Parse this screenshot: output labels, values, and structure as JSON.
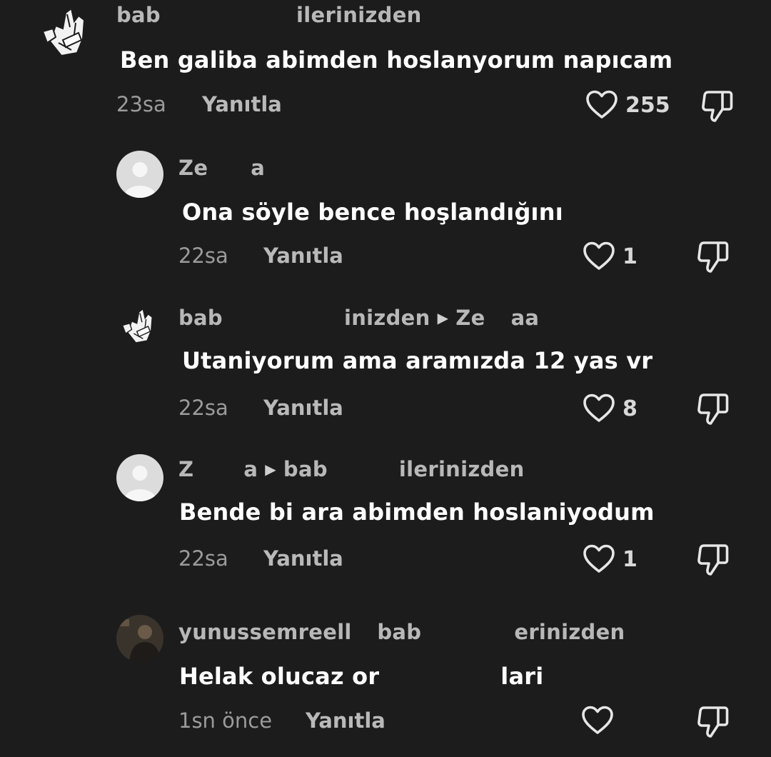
{
  "comments": [
    {
      "author": "bab",
      "author_tail": "ilerinizden",
      "text": "Ben galiba abimden hoslanyorum napıcam",
      "time": "23sa",
      "reply": "Yanıtla",
      "likes": "255",
      "avatar": "hand-icon"
    },
    {
      "author": "Ze",
      "author_tail": "a",
      "text": "Ona söyle bence hoşlandığını",
      "time": "22sa",
      "reply": "Yanıtla",
      "likes": "1",
      "avatar": "default-avatar-icon"
    },
    {
      "author": "bab",
      "author_tail": "inizden",
      "reply_to": "Ze",
      "reply_to_tail": "aa",
      "text": "Utaniyorum ama aramızda 12 yas vr",
      "time": "22sa",
      "reply": "Yanıtla",
      "likes": "8",
      "avatar": "hand-icon"
    },
    {
      "author": "Z",
      "author_tail": "a",
      "reply_to": "bab",
      "reply_to_tail": "ilerinizden",
      "text": "Bende bi ara abimden hoslaniyodum",
      "time": "22sa",
      "reply": "Yanıtla",
      "likes": "1",
      "avatar": "default-avatar-icon"
    },
    {
      "author": "yunussemreell",
      "reply_to": "bab",
      "reply_to_tail": "erinizden",
      "text": "Helak olucaz or",
      "text_tail": "lari",
      "time": "1sn önce",
      "reply": "Yanıtla",
      "likes": "",
      "avatar": "photo-avatar"
    }
  ],
  "colors": {
    "background": "#1c1c1c",
    "text": "#ffffff",
    "username": "#b8b8b8",
    "timestamp": "#9b9b9b"
  }
}
